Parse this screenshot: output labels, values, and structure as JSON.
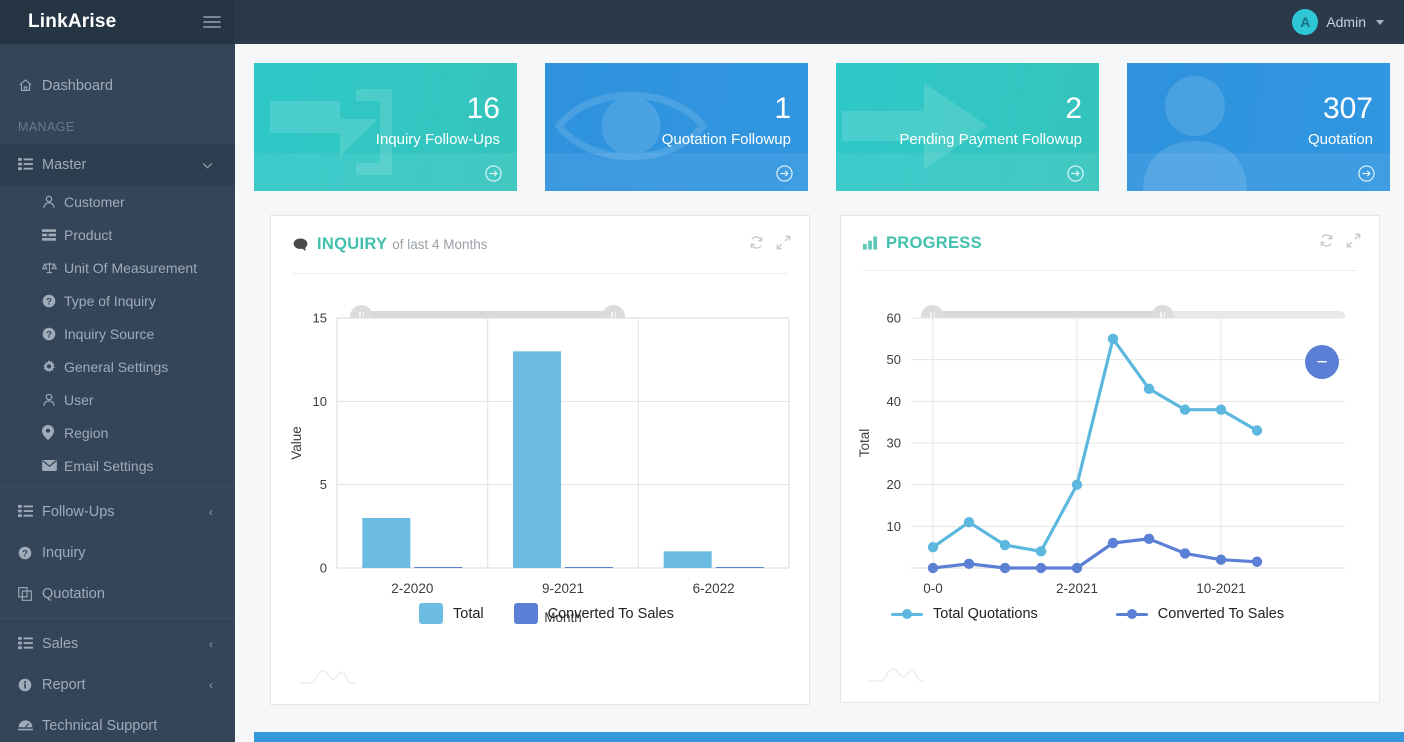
{
  "topbar": {
    "brand": "LinkArise",
    "menu_icon": "hamburger-icon",
    "avatar_initial": "A",
    "admin_label": "Admin"
  },
  "sidebar": {
    "dashboard": {
      "label": "Dashboard",
      "icon": "home-icon"
    },
    "section_label": "MANAGE",
    "master": {
      "label": "Master",
      "icon": "list-icon",
      "chevron": "∨",
      "active": true
    },
    "master_children": [
      {
        "label": "Customer",
        "icon": "user-icon"
      },
      {
        "label": "Product",
        "icon": "product-icon"
      },
      {
        "label": "Unit Of Measurement",
        "icon": "scale-icon"
      },
      {
        "label": "Type of Inquiry",
        "icon": "question-circle-icon"
      },
      {
        "label": "Inquiry Source",
        "icon": "question-circle-icon"
      },
      {
        "label": "General Settings",
        "icon": "gear-icon"
      },
      {
        "label": "User",
        "icon": "user-icon"
      },
      {
        "label": "Region",
        "icon": "map-pin-icon"
      },
      {
        "label": "Email Settings",
        "icon": "envelope-icon"
      }
    ],
    "bottom_items": [
      {
        "label": "Follow-Ups",
        "icon": "list-icon",
        "chevron": "‹"
      },
      {
        "label": "Inquiry",
        "icon": "question-circle-icon",
        "chevron": ""
      },
      {
        "label": "Quotation",
        "icon": "copy-icon",
        "chevron": ""
      },
      {
        "label": "Sales",
        "icon": "list-icon",
        "chevron": "‹"
      },
      {
        "label": "Report",
        "icon": "info-circle-icon",
        "chevron": "‹"
      },
      {
        "label": "Technical Support",
        "icon": "support-icon",
        "chevron": ""
      }
    ]
  },
  "cards": [
    {
      "value": "16",
      "title": "Inquiry Follow-Ups",
      "theme": "teal",
      "color": "#2ec8c8",
      "watermark": "arrow-into-box-icon"
    },
    {
      "value": "1",
      "title": "Quotation Followup",
      "theme": "blue",
      "color": "#2e92dd",
      "watermark": "eye-icon"
    },
    {
      "value": "2",
      "title": "Pending Payment Followup",
      "theme": "teal",
      "color": "#2ec8c8",
      "watermark": "arrow-right-icon"
    },
    {
      "value": "307",
      "title": "Quotation",
      "theme": "blue",
      "color": "#2e92dd",
      "watermark": "user-icon"
    }
  ],
  "panels": {
    "inquiry": {
      "title": "INQUIRY",
      "subtitle": "of last 4 Months",
      "title_icon": "comment-icon",
      "refresh_icon": "refresh-icon",
      "expand_icon": "expand-icon",
      "title_color": "#41c0ad"
    },
    "progress": {
      "title": "PROGRESS",
      "subtitle": "",
      "title_icon": "bar-chart-icon",
      "refresh_icon": "refresh-icon",
      "expand_icon": "expand-icon",
      "title_color": "#41c0ad"
    }
  },
  "chart_data": [
    {
      "type": "bar",
      "title": "INQUIRY",
      "subtitle": "of last 4 Months",
      "categories": [
        "2-2020",
        "9-2021",
        "6-2022"
      ],
      "series": [
        {
          "name": "Total",
          "values": [
            3,
            13,
            1
          ],
          "color": "#6bbce0"
        },
        {
          "name": "Converted To Sales",
          "values": [
            0,
            0,
            0
          ],
          "color": "#5b7fd4"
        }
      ],
      "xlabel": "Month",
      "ylabel": "Value",
      "ylim": [
        0,
        15
      ],
      "yticks": [
        0,
        5,
        10,
        15
      ],
      "grid": true,
      "legend": "bottom"
    },
    {
      "type": "line",
      "title": "PROGRESS",
      "x_ticks_shown": [
        "0-0",
        "2-2021",
        "10-2021"
      ],
      "x_index": [
        0,
        1,
        2,
        3,
        4,
        5,
        6,
        7,
        8,
        9,
        10
      ],
      "series": [
        {
          "name": "Total Quotations",
          "color": "#5cb8de",
          "values": [
            5,
            11,
            5.5,
            4,
            20,
            55,
            43,
            38,
            38,
            33
          ]
        },
        {
          "name": "Converted To Sales",
          "color": "#5b7fd4",
          "values": [
            0,
            1,
            0,
            0,
            0,
            6,
            7,
            3.5,
            2,
            1.5
          ]
        }
      ],
      "ylabel": "Total",
      "xlabel": "",
      "ylim": [
        0,
        60
      ],
      "yticks": [
        0,
        10,
        20,
        30,
        40,
        50,
        60
      ],
      "grid": true,
      "legend": "bottom",
      "annotation_badge": "−"
    }
  ],
  "colors": {
    "sidebar_bg": "#34455a",
    "topbar_bg": "#2b3a4a",
    "accent_teal": "#41c0ad",
    "accent_blue": "#3498db",
    "bar_total": "#6bbce0",
    "converted": "#5b7fd4"
  }
}
